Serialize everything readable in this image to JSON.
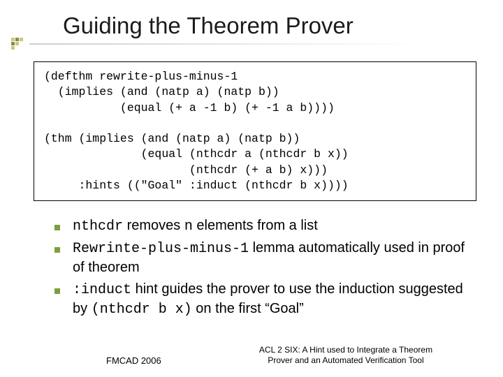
{
  "title": "Guiding the Theorem Prover",
  "code": "(defthm rewrite-plus-minus-1\n  (implies (and (natp a) (natp b))\n           (equal (+ a -1 b) (+ -1 a b))))\n\n(thm (implies (and (natp a) (natp b))\n              (equal (nthcdr a (nthcdr b x))\n                     (nthcdr (+ a b) x)))\n     :hints ((\"Goal\" :induct (nthcdr b x))))",
  "bullets": {
    "b1": {
      "code1": "nthcdr",
      "t1": " removes ",
      "code2": "n",
      "t2": " elements from a list"
    },
    "b2": {
      "code1": "Rewrinte-plus-minus-1",
      "t1": " lemma automatically used in proof of theorem"
    },
    "b3": {
      "code1": ":induct",
      "t1": " hint guides the prover to use the induction suggested by ",
      "code2": "(nthcdr b x)",
      "t2": " on the first “Goal”"
    }
  },
  "footer": {
    "left": "FMCAD 2006",
    "right": "ACL 2 SIX: A Hint used to Integrate a Theorem Prover and an Automated Verification Tool"
  }
}
